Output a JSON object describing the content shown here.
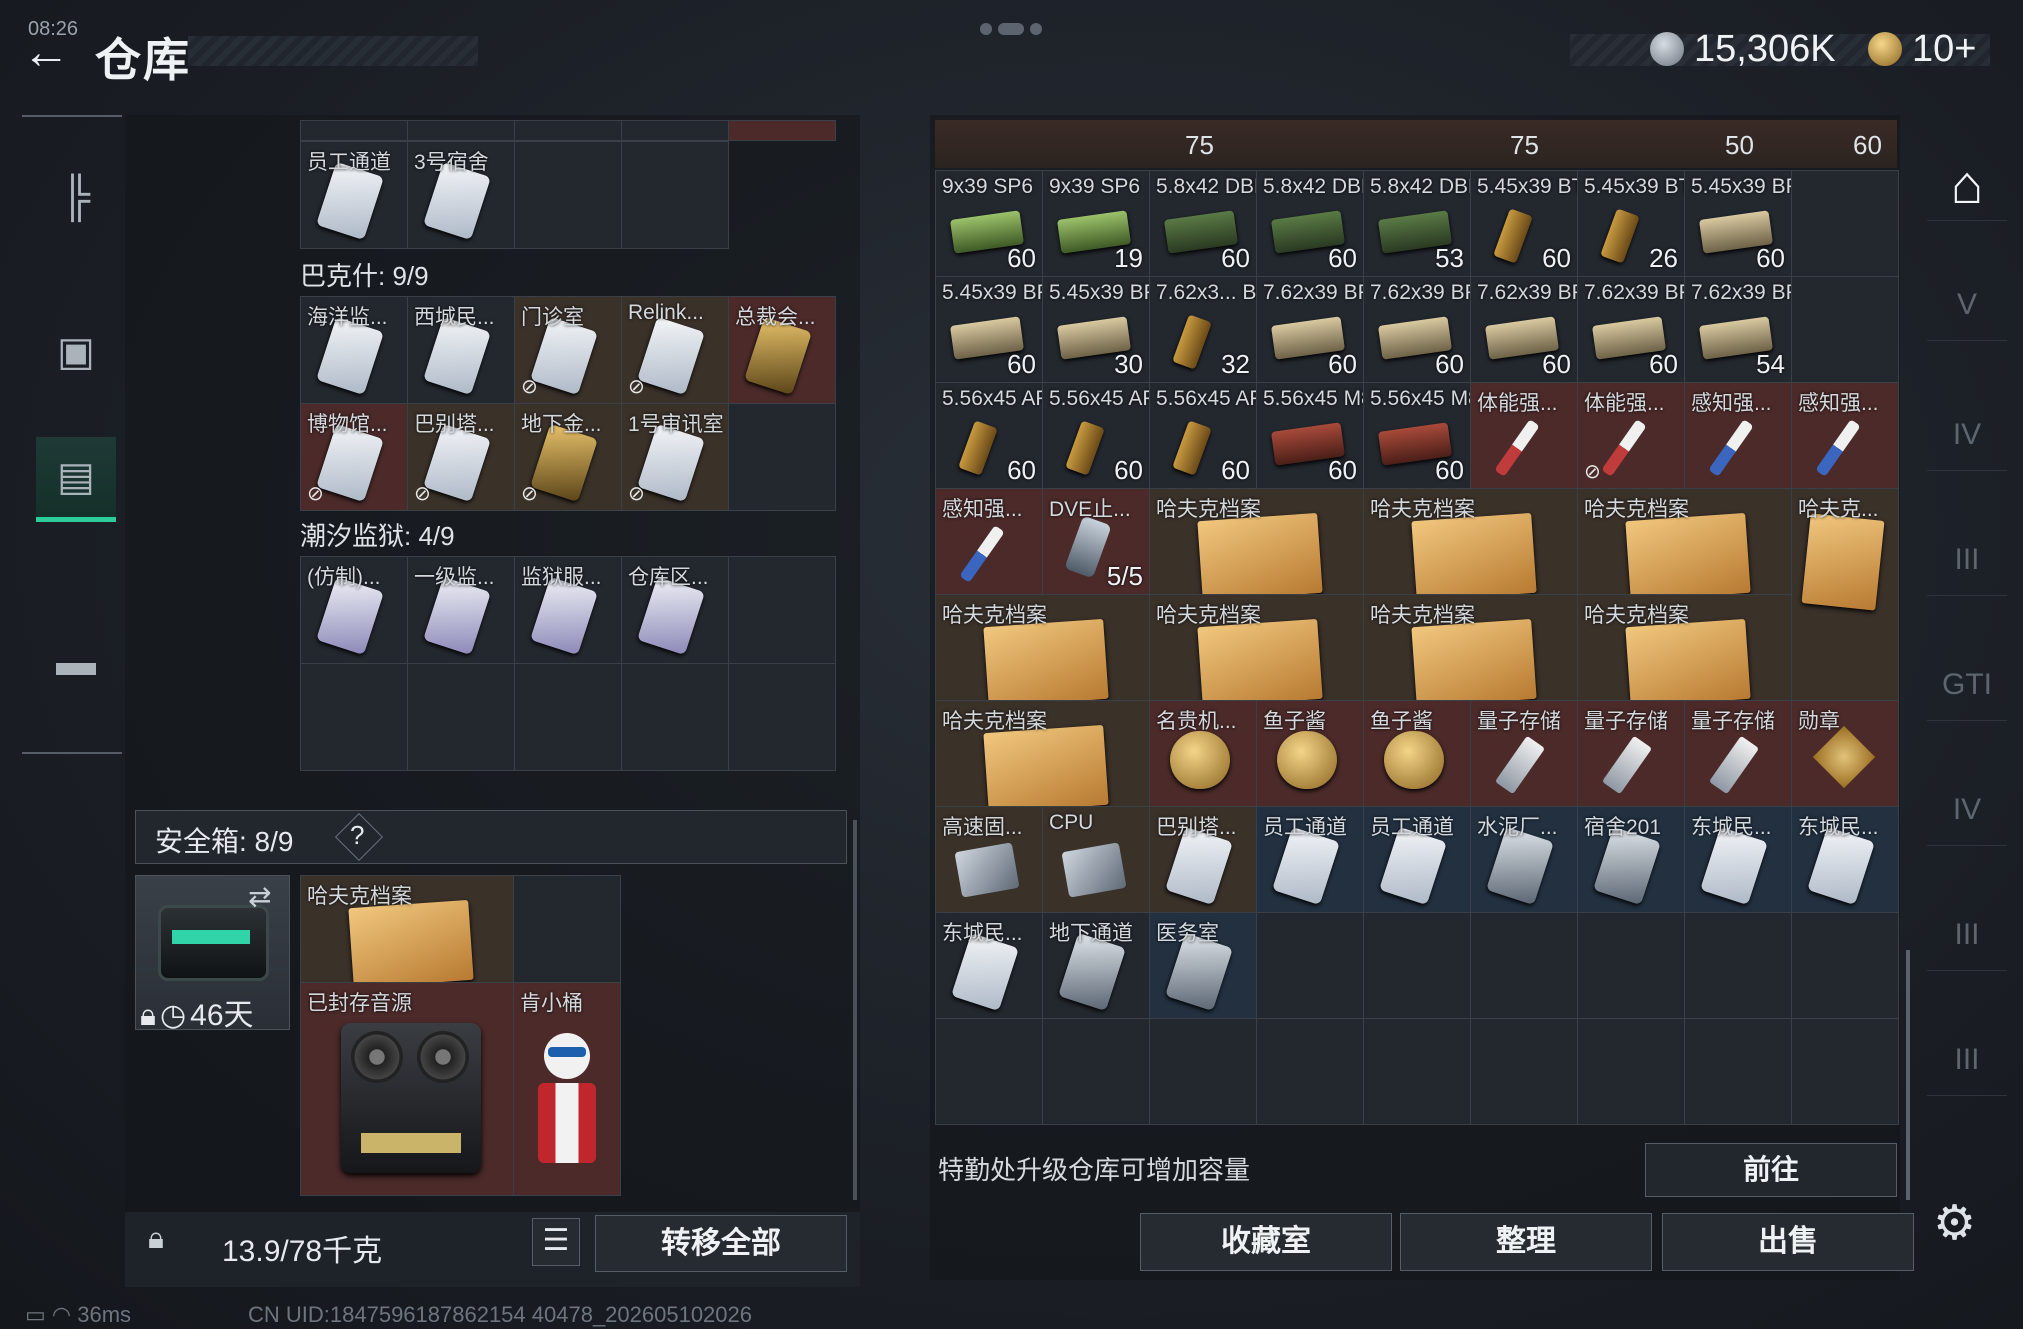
{
  "header": {
    "back_icon": "back-arrow-icon",
    "title": "仓库",
    "currency_value": "15,306K",
    "token_value": "10+",
    "clock": "08:26"
  },
  "left_rail": {
    "items": [
      "weapon-icon",
      "backpack-icon",
      "storage-icon",
      "briefcase-icon"
    ]
  },
  "top_partial": {
    "items": [
      {
        "label": "员工通道",
        "icon": "keycard"
      },
      {
        "label": "3号宿舍",
        "icon": "keycard"
      }
    ]
  },
  "sections": [
    {
      "title": "巴克什: 9/9",
      "items": [
        {
          "label": "海洋监...",
          "color": "default"
        },
        {
          "label": "西城民...",
          "color": "default"
        },
        {
          "label": "门诊室",
          "color": "brown",
          "nolock": true
        },
        {
          "label": "Relink...",
          "color": "brown",
          "nolock": true
        },
        {
          "label": "总裁会...",
          "color": "red",
          "gold": true
        },
        {
          "label": "博物馆...",
          "color": "red",
          "nolock": true
        },
        {
          "label": "巴别塔...",
          "color": "brown",
          "nolock": true
        },
        {
          "label": "地下金...",
          "color": "brown",
          "nolock": true,
          "gold": true
        },
        {
          "label": "1号审讯室",
          "color": "brown",
          "nolock": true
        }
      ]
    },
    {
      "title": "潮汐监狱: 4/9",
      "items": [
        {
          "label": "(仿制)...",
          "color": "default"
        },
        {
          "label": "一级监...",
          "color": "default"
        },
        {
          "label": "监狱服...",
          "color": "default"
        },
        {
          "label": "仓库区...",
          "color": "default"
        }
      ]
    }
  ],
  "safe_box": {
    "label": "安全箱: 8/9",
    "help": "?",
    "days": "46天",
    "swap_icon": "swap-icon",
    "lock_icon": "lock-icon",
    "clock_icon": "clock-icon",
    "items": [
      {
        "label": "哈夫克档案"
      },
      {
        "label": "已封存音源"
      },
      {
        "label": "肯小桶"
      }
    ]
  },
  "weight": {
    "value": "13.9/78千克",
    "transfer_label": "转移全部",
    "list_icon": "list-icon",
    "kg_icon": "kg-weight-icon"
  },
  "right_top_row": {
    "values": [
      "75",
      "75",
      "50",
      "60"
    ]
  },
  "right_grid": [
    [
      {
        "l": "9x39 SP6",
        "c": "60",
        "k": "green"
      },
      {
        "l": "9x39 SP6",
        "c": "19",
        "k": "green"
      },
      {
        "l": "5.8x42 DBP10",
        "c": "60",
        "k": "olive"
      },
      {
        "l": "5.8x42 DBP10",
        "c": "60",
        "k": "olive"
      },
      {
        "l": "5.8x42 DBP10",
        "c": "53",
        "k": "olive"
      },
      {
        "l": "5.45x39 BT-ST",
        "c": "60",
        "k": "bullet"
      },
      {
        "l": "5.45x39 BT-ST",
        "c": "26",
        "k": "bullet"
      },
      {
        "l": "5.45x39 BP",
        "c": "60",
        "k": "tan"
      }
    ],
    [
      {
        "l": "5.45x39 BP",
        "c": "60",
        "k": "tan"
      },
      {
        "l": "5.45x39 BP",
        "c": "30",
        "k": "tan"
      },
      {
        "l": "7.62x3... BP SUB",
        "c": "32",
        "k": "bullet"
      },
      {
        "l": "7.62x39 BP",
        "c": "60",
        "k": "tan"
      },
      {
        "l": "7.62x39 BP",
        "c": "60",
        "k": "tan"
      },
      {
        "l": "7.62x39 BP",
        "c": "60",
        "k": "tan"
      },
      {
        "l": "7.62x39 BP",
        "c": "60",
        "k": "tan"
      },
      {
        "l": "7.62x39 BP",
        "c": "54",
        "k": "tan"
      }
    ],
    [
      {
        "l": "5.56x45 APC",
        "c": "60",
        "k": "bullet"
      },
      {
        "l": "5.56x45 APC",
        "c": "60",
        "k": "bullet"
      },
      {
        "l": "5.56x45 APC",
        "c": "60",
        "k": "bullet"
      },
      {
        "l": "5.56x45 M855A1",
        "c": "60",
        "k": "red"
      },
      {
        "l": "5.56x45 M855A1",
        "c": "60",
        "k": "red"
      },
      {
        "l": "体能强...",
        "c": "",
        "k": "syr-r"
      },
      {
        "l": "体能强...",
        "c": "",
        "k": "syr-r",
        "nolock": true
      },
      {
        "l": "感知强...",
        "c": "",
        "k": "syr-b"
      },
      {
        "l": "感知强...",
        "c": "",
        "k": "syr-b"
      }
    ]
  ],
  "right_grid_rows2": {
    "row4": [
      {
        "l": "感知强...",
        "k": "syr-b"
      },
      {
        "l": "DVE止...",
        "c": "5/5",
        "k": "dve"
      },
      {
        "l": "哈夫克档案",
        "k": "folder"
      },
      {
        "l": "哈夫克档案",
        "k": "folder"
      },
      {
        "l": "哈夫克档案",
        "k": "folder"
      },
      {
        "l": "哈夫克...",
        "k": "folder-s"
      }
    ],
    "row5": [
      {
        "l": "哈夫克档案"
      },
      {
        "l": "哈夫克档案"
      },
      {
        "l": "哈夫克档案"
      },
      {
        "l": "哈夫克档案"
      }
    ],
    "row6": [
      {
        "l": "哈夫克档案",
        "k": "folder"
      },
      {
        "l": "名贵机...",
        "k": "watch"
      },
      {
        "l": "鱼子酱",
        "k": "round"
      },
      {
        "l": "鱼子酱",
        "k": "round"
      },
      {
        "l": "量子存储",
        "k": "usb"
      },
      {
        "l": "量子存储",
        "k": "usb"
      },
      {
        "l": "量子存储",
        "k": "usb"
      },
      {
        "l": "勋章",
        "k": "medal"
      }
    ],
    "row7": [
      {
        "l": "高速固...",
        "k": "chip"
      },
      {
        "l": "CPU",
        "k": "chip"
      },
      {
        "l": "巴别塔...",
        "k": "card"
      },
      {
        "l": "员工通道",
        "k": "card"
      },
      {
        "l": "员工通道",
        "k": "card"
      },
      {
        "l": "水泥厂...",
        "k": "dark"
      },
      {
        "l": "宿舍201",
        "k": "dark"
      },
      {
        "l": "东城民...",
        "k": "card"
      },
      {
        "l": "东城民...",
        "k": "card"
      }
    ],
    "row8": [
      {
        "l": "东城民...",
        "k": "card"
      },
      {
        "l": "地下通道",
        "k": "dark"
      },
      {
        "l": "医务室",
        "k": "dark"
      }
    ]
  },
  "footer": {
    "upgrade_text": "特勤处升级仓库可增加容量",
    "goto_label": "前往",
    "collection_label": "收藏室",
    "organize_label": "整理",
    "sell_label": "出售"
  },
  "right_rail": {
    "items": [
      "storage-home-icon",
      "V",
      "IV",
      "III",
      "GTI",
      "IV",
      "III",
      "III"
    ],
    "settings_icon": "gear-icon"
  },
  "status": {
    "ping": "36ms",
    "uid": "CN UID:1847596187862154 40478_202605102026"
  }
}
